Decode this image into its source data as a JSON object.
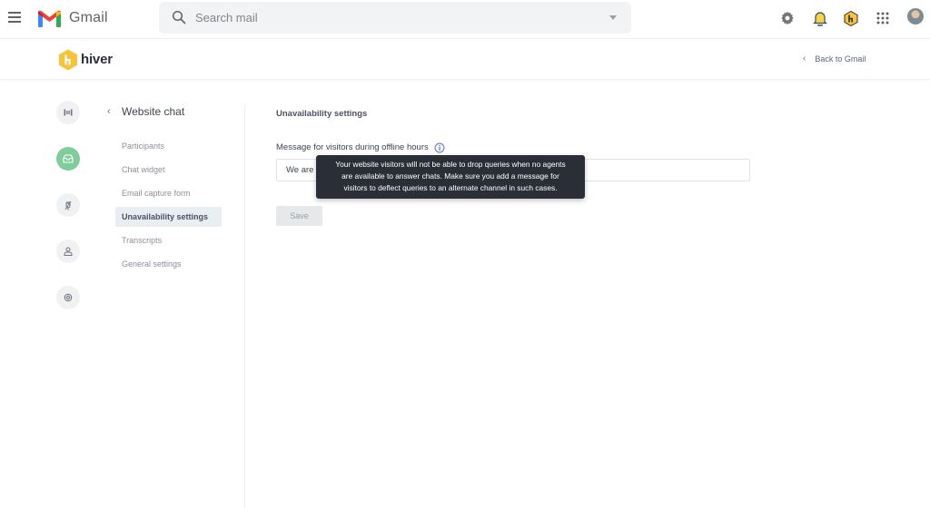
{
  "gmail": {
    "app_name": "Gmail",
    "search": {
      "placeholder": "Search mail",
      "value": ""
    },
    "icons": [
      "menu-icon",
      "search-icon",
      "dropdown-icon",
      "settings-gear-icon",
      "notifications-bell-icon",
      "hiver-extension-icon",
      "apps-grid-icon",
      "account-avatar"
    ]
  },
  "hiver": {
    "brand": "hiver",
    "back_link": "Back to Gmail",
    "brand_color": "#f7c23c"
  },
  "rail": {
    "items": [
      {
        "name": "shared-inbox",
        "icon": "columns-icon",
        "active": false
      },
      {
        "name": "website-chat",
        "icon": "inbox-icon",
        "active": true
      },
      {
        "name": "integrations",
        "icon": "plug-icon",
        "active": false
      },
      {
        "name": "users",
        "icon": "user-icon",
        "active": false
      },
      {
        "name": "settings",
        "icon": "gear-icon",
        "active": false
      }
    ],
    "active_color": "#7fcd9c"
  },
  "settings_nav": {
    "title": "Website chat",
    "back_glyph": "‹",
    "items": [
      {
        "label": "Participants",
        "active": false
      },
      {
        "label": "Chat widget",
        "active": false
      },
      {
        "label": "Email capture form",
        "active": false
      },
      {
        "label": "Unavailability settings",
        "active": true
      },
      {
        "label": "Transcripts",
        "active": false
      },
      {
        "label": "General settings",
        "active": false
      }
    ]
  },
  "main": {
    "section_title": "Unavailability settings",
    "field_label": "Message for visitors during offline hours",
    "message_value": "We are away right now. Please drop us an email and we will get back to you.",
    "save_label": "Save",
    "tooltip": {
      "lines": [
        "Your website visitors will not be able to drop queries when no agents",
        "are available to answer chats. Make sure you add a message for",
        "visitors to deflect queries to an alternate channel in such cases."
      ]
    }
  }
}
